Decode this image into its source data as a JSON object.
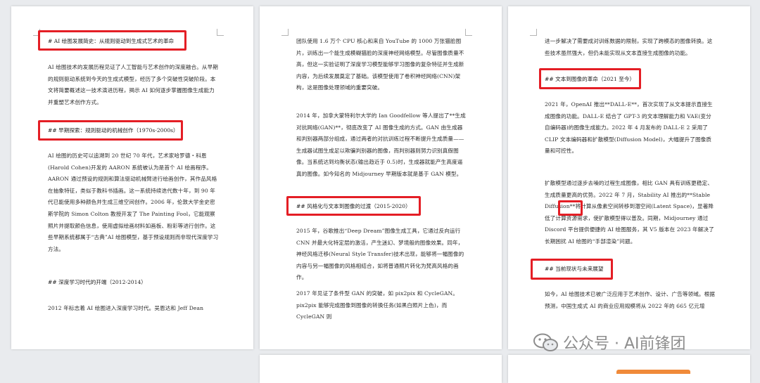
{
  "pages": [
    {
      "heading": "# AI 绘图发展简史：从规则驱动到生成式艺术的革命",
      "para1": "AI 绘图技术的发展历程见证了人工智能与艺术创作的深度融合。从早期的规则驱动系统到今天的生成式模型，经历了多个突破性突破阶段。本文将简要概述这一技术演进历程，揭示 AI 如何逐步掌握图像生成能力并重塑艺术创作方式。",
      "section1": "## 早期探索：规则驱动的机械创作（1970s-2000s）",
      "para2": "AI 绘图的历史可以追溯到 20 世纪 70 年代，艺术家哈罗德・科恩(Harold Cohen)开发的 AARON 系统被认为是首个 AI 绘画程序。AARON 通过预设的规则和算法驱动机械臂进行绘画创作，其作品风格在抽象特征，类似于教科书插画。这一系统持续迭代数十年，到 90 年代已能使用多种颜色并生成三维空间创作。2006 年，伦敦大学金史密斯学院的 Simon Colton 教授开发了 The Painting Fool，它能观察照片并提取颜色信息，使用虚拟绘画材料如画板、粉彩等进行创作。这些早期系统都属于“古典”AI 绘图模型，基于预设规则而非现代深度学习方法。",
      "section2": "## 深度学习时代的开端（2012-2014）",
      "para3": "2012 年标志着 AI 绘图进入深度学习时代。吴恩达和 Jeff Dean"
    },
    {
      "para1": "团队使用 1.6 万个 CPU 核心和来自 YouTube 的 1000 万张猫脸图片，训练出一个能生成模糊猫脸的深度神经网络模型。尽管图像质量不高，但这一实验证明了深度学习模型能够学习图像的复杂特征并生成新内容，为后续发展奠定了基础。该模型使用了卷积神经网络(CNN)架构，这是图像处理领域的重要突破。",
      "para2": "2014 年，加拿大蒙特利尔大学的 Ian Goodfellow 等人提出了**生成对抗网络(GAN)**，彻底改变了 AI 图像生成的方式。GAN 由生成器和判别器两部分组成，通过两者的对抗训练过程不断提升生成质量——生成器试图生成足以欺骗判别器的图像，而判别器则努力识别真假图像。当系统达到均衡状态(输出趋近于 0.5)时，生成器就能产生高度逼真的图像。如今知名的 Midjourney 早期版本就是基于 GAN 模型。",
      "section1": "## 风格化与文本到图像的过渡（2015-2020）",
      "para3": "2015 年，谷歌推出“Deep Dream”图像生成工具，它通过反向运行 CNN 并最大化特定层的激活，产生迷幻、梦境般的图像效果。同年，神经风格迁移(Neural Style Transfer)技术出现，能够将一幅图像的内容与另一幅图像的风格相结合，如将普通照片转化为梵高风格的画作。",
      "para4": "2017 年见证了条件型 GAN 的突破，如 pix2pix 和 CycleGAN。pix2pix 能够完成图像到图像的转换任务(如黑白照片上色)，而 CycleGAN 则"
    },
    {
      "para1": "进一步解决了需要成对训练数据的限制，实现了跨模态的图像转换。这些技术虽然强大，但仍未能实现从文本直接生成图像的功能。",
      "section1": "## 文本到图像的革命（2021 至今）",
      "para2": "2021 年，OpenAI 推出**DALL-E**，首次实现了从文本提示直接生成图像的功能。DALL-E 结合了 GPT-3 的文本理解能力和 VAE(变分自编码器)的图像生成能力。2022 年 4 月发布的 DALL-E 2 采用了 CLIP 文本编码器和扩散模型(Diffusion Model)，大幅提升了图像质量和可控性。",
      "para3": "扩散模型通过逐步去噪的过程生成图像，相比 GAN 具有训练更稳定、生成质量更高的优势。2022 年 7 月，Stability AI 推出的**Stable Diffusion**将计算从像素空间转移到潜空间(Latent Space)，显著降低了计算资源需求，使扩散模型得以普及。同期，Midjourney 通过 Discord 平台提供便捷的 AI 绘图服务，其 V5 版本在 2023 年解决了长期困扰 AI 绘图的“手部渲染”问题。",
      "section2": "## 当前现状与未来展望",
      "para4": "如今，AI 绘图技术已被广泛应用于艺术创作、设计、广告等领域。根据预测，中国生成式 AI 的商业应用规模将从 2022 年的 665 亿元增"
    }
  ],
  "watermark": {
    "text": "公众号 · AI前锋团",
    "icon": "wechat-icon"
  },
  "colors": {
    "highlight": "#e41e25",
    "page": "#ffffff",
    "background": "#e9ebee"
  }
}
